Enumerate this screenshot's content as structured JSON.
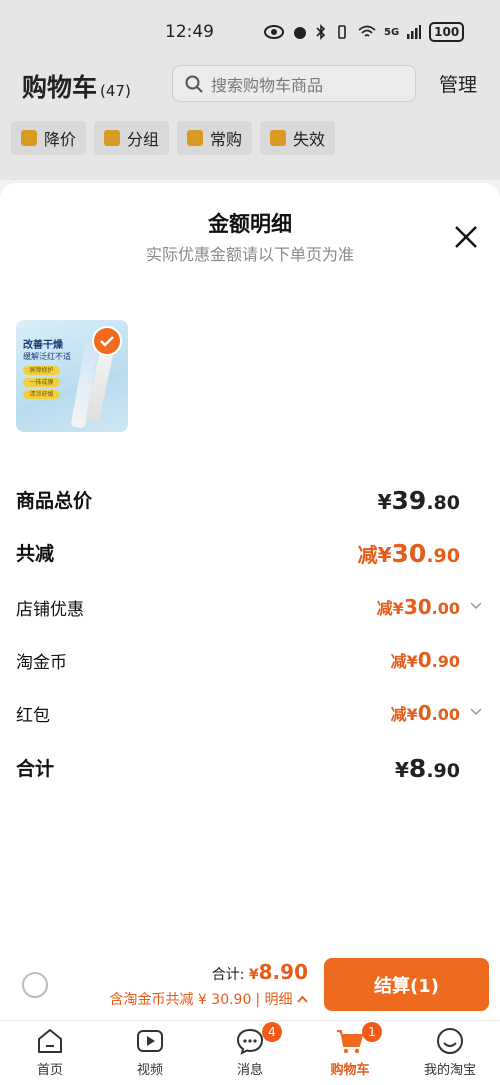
{
  "status_bar": {
    "time": "12:49",
    "network": "5G",
    "battery": "100"
  },
  "header": {
    "title": "购物车",
    "count": "(47)",
    "search_placeholder": "搜索购物车商品",
    "manage": "管理",
    "filters": [
      "降价",
      "分组",
      "常购",
      "失效"
    ]
  },
  "sheet": {
    "title": "金额明细",
    "subtitle": "实际优惠金额请以下单页为准",
    "product": {
      "line1": "改善干燥",
      "line2": "缓解泛红不适",
      "tags": [
        "屏障修护",
        "一抹成膜",
        "清凉舒缓"
      ]
    },
    "rows": {
      "goods_total": {
        "label": "商品总价",
        "prefix": "¥",
        "int": "39",
        "dec": ".80"
      },
      "total_discount": {
        "label": "共减",
        "prefix": "减¥",
        "int": "30",
        "dec": ".90"
      },
      "shop_discount": {
        "label": "店铺优惠",
        "prefix": "减¥",
        "int": "30",
        "dec": ".00"
      },
      "taojinbi": {
        "label": "淘金币",
        "prefix": "减¥",
        "int": "0",
        "dec": ".90"
      },
      "red_packet": {
        "label": "红包",
        "prefix": "减¥",
        "int": "0",
        "dec": ".00"
      },
      "sum": {
        "label": "合计",
        "prefix": "¥",
        "int": "8",
        "dec": ".90"
      }
    }
  },
  "checkout": {
    "total_label": "合计:",
    "total_prefix": "¥",
    "total_amount": "8.90",
    "discount_text": "含淘金币共减 ¥ 30.90",
    "detail_text": "| 明细",
    "button": "结算(1)"
  },
  "tabs": [
    {
      "label": "首页",
      "icon": "home-icon"
    },
    {
      "label": "视频",
      "icon": "video-icon"
    },
    {
      "label": "消息",
      "icon": "message-icon",
      "badge": "4"
    },
    {
      "label": "购物车",
      "icon": "cart-icon",
      "badge": "1",
      "active": true
    },
    {
      "label": "我的淘宝",
      "icon": "profile-icon"
    }
  ],
  "colors": {
    "accent": "#ee6a1f",
    "discount": "#e65c1a"
  }
}
